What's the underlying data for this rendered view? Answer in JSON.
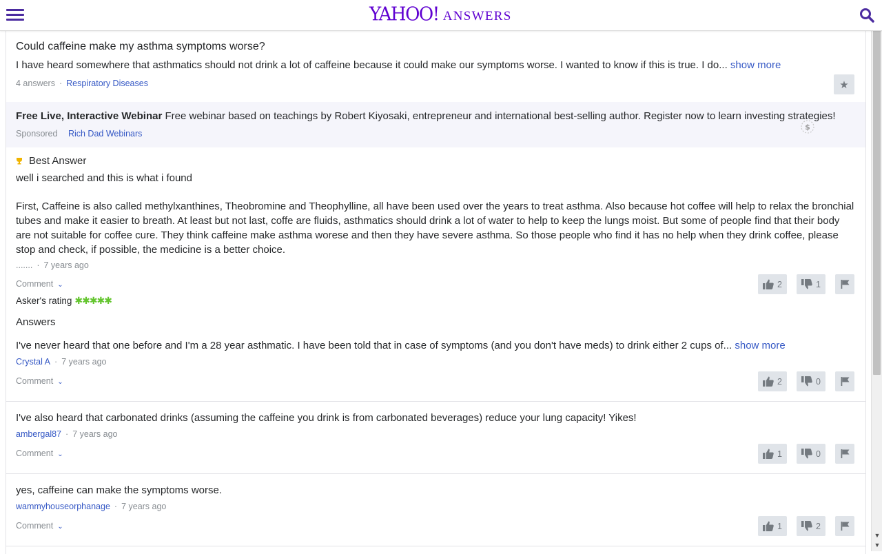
{
  "header": {
    "logo_yahoo": "YAHOO!",
    "logo_answers": "ANSWERS",
    "menu_icon": "hamburger-menu-icon",
    "search_icon": "search-icon",
    "brand_color": "#5f01d1"
  },
  "question": {
    "title": "Could caffeine make my asthma symptoms worse?",
    "body": "I have heard somewhere that asthmatics should not drink a lot of caffeine because it could make our symptoms worse. I wanted to know if this is true. I do...",
    "show_more": "show more",
    "answer_count": "4 answers",
    "separator": "·",
    "category": "Respiratory Diseases",
    "star_icon": "star-icon"
  },
  "ad": {
    "title": "Free Live, Interactive Webinar",
    "text": "Free webinar based on teachings by Robert Kiyosaki, entrepreneur and international best-selling author. Register now to learn investing strategies!",
    "sponsored_label": "Sponsored",
    "sponsor": "Rich Dad Webinars",
    "icon": "sponsored-dollar-icon"
  },
  "best_answer": {
    "label": "Best Answer",
    "line1": "well i searched and this is what i found",
    "paragraph": "First, Caffeine is also called methylxanthines, Theobromine and Theophylline, all have been used over the years to treat asthma. Also because hot coffee will help to relax the bronchial tubes and make it easier to breath. At least but not last, coffe are fluids, asthmatics should drink a lot of water to help to keep the lungs moist. But some of people find that their body are not suitable for coffee cure. They think caffeine make asthma worese and then they have severe asthma. So those people who find it has no help when they drink coffee, please stop and check, if possible, the medicine is a better choice.",
    "author": ".......",
    "time": "7 years ago",
    "comment_label": "Comment",
    "upvotes": "2",
    "downvotes": "1",
    "rating_label": "Asker's rating",
    "rating_stars": "✱✱✱✱✱",
    "rating_value": 5
  },
  "answers_heading": "Answers",
  "answers": [
    {
      "text": "I've never heard that one before and I'm a 28 year asthmatic. I have been told that in case of symptoms (and you don't have meds) to drink either 2 cups of...",
      "show_more": "show more",
      "author": "Crystal A",
      "time": "7 years ago",
      "comment_label": "Comment",
      "upvotes": "2",
      "downvotes": "0"
    },
    {
      "text": "I've also heard that carbonated drinks (assuming the caffeine you drink is from carbonated beverages) reduce your lung capacity! Yikes!",
      "author": "ambergal87",
      "time": "7 years ago",
      "comment_label": "Comment",
      "upvotes": "1",
      "downvotes": "0"
    },
    {
      "text": "yes, caffeine can make the symptoms worse.",
      "author": "wammyhouseorphanage",
      "time": "7 years ago",
      "comment_label": "Comment",
      "upvotes": "1",
      "downvotes": "2"
    }
  ]
}
